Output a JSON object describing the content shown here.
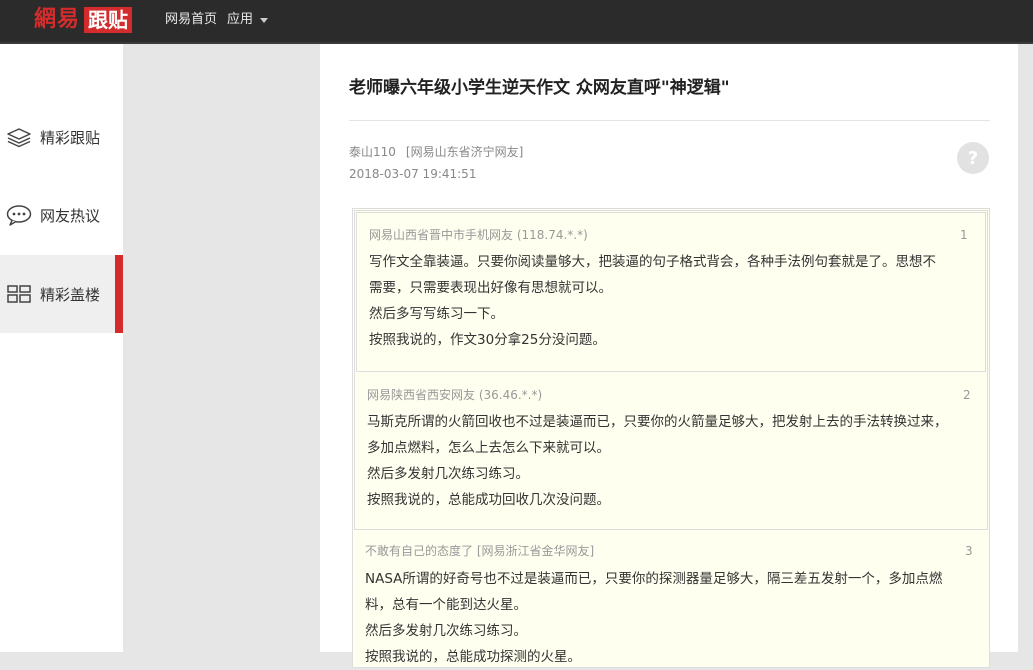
{
  "header": {
    "logo_text": "網易",
    "logo_badge": "跟贴",
    "nav_home": "网易首页",
    "nav_app": "应用"
  },
  "sidebar": {
    "items": [
      {
        "label": "精彩跟贴",
        "icon": "layers-icon",
        "active": false
      },
      {
        "label": "网友热议",
        "icon": "chat-bubble-icon",
        "active": false
      },
      {
        "label": "精彩盖楼",
        "icon": "grid-icon",
        "active": true
      }
    ]
  },
  "post": {
    "title": "老师曝六年级小学生逆天作文 众网友直呼\"神逻辑\"",
    "author": "泰山110",
    "location": "[网易山东省济宁网友]",
    "time": "2018-03-07 19:41:51"
  },
  "comments": [
    {
      "header": "网易山西省晋中市手机网友 (118.74.*.*)",
      "floor": "1",
      "lines": [
        "写作文全靠装逼。只要你阅读量够大，把装逼的句子格式背会，各种手法例句套就是了。思想不",
        "需要，只需要表现出好像有思想就可以。",
        "然后多写写练习一下。",
        "按照我说的，作文30分拿25分没问题。"
      ]
    },
    {
      "header": "网易陕西省西安网友 (36.46.*.*)",
      "floor": "2",
      "lines": [
        "马斯克所谓的火箭回收也不过是装逼而已，只要你的火箭量足够大，把发射上去的手法转换过来，",
        "多加点燃料，怎么上去怎么下来就可以。",
        "然后多发射几次练习练习。",
        "按照我说的，总能成功回收几次没问题。"
      ]
    },
    {
      "header": "不敢有自己的态度了 [网易浙江省金华网友]",
      "floor": "3",
      "lines": [
        "NASA所谓的好奇号也不过是装逼而已，只要你的探测器量足够大，隔三差五发射一个，多加点燃",
        "料，总有一个能到达火星。",
        "然后多发射几次练习练习。",
        "按照我说的，总能成功探测的火星。"
      ]
    }
  ],
  "colors": {
    "accent": "#d42c2c",
    "topbar": "#2b2b2b",
    "comment_bg": "#fffff0"
  }
}
